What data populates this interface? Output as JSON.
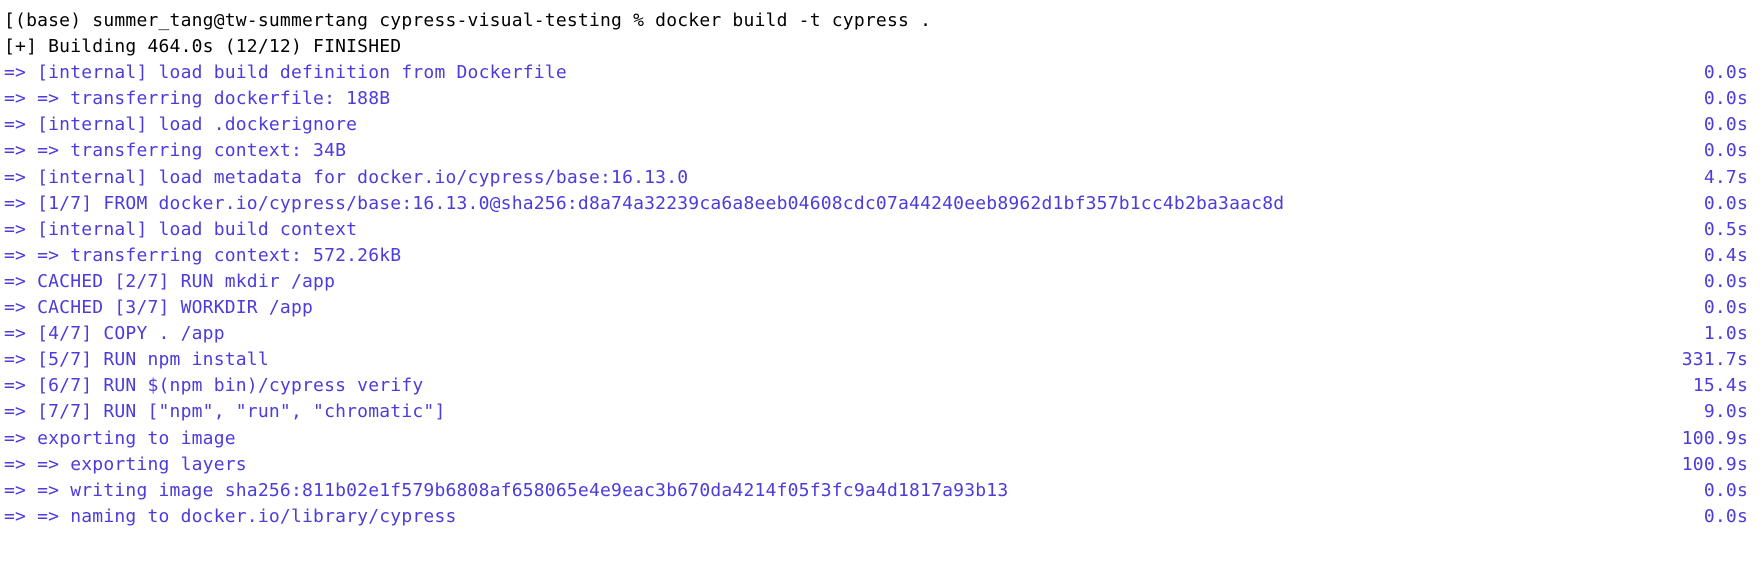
{
  "prompt": {
    "text": "[(base) summer_tang@tw-summertang cypress-visual-testing % docker build -t cypress ."
  },
  "status": {
    "text": "[+] Building 464.0s (12/12) FINISHED"
  },
  "lines": [
    {
      "left": " => [internal] load build definition from Dockerfile",
      "right": "0.0s"
    },
    {
      "left": " => => transferring dockerfile: 188B",
      "right": "0.0s"
    },
    {
      "left": " => [internal] load .dockerignore",
      "right": "0.0s"
    },
    {
      "left": " => => transferring context: 34B",
      "right": "0.0s"
    },
    {
      "left": " => [internal] load metadata for docker.io/cypress/base:16.13.0",
      "right": "4.7s"
    },
    {
      "left": " => [1/7] FROM docker.io/cypress/base:16.13.0@sha256:d8a74a32239ca6a8eeb04608cdc07a44240eeb8962d1bf357b1cc4b2ba3aac8d",
      "right": "0.0s"
    },
    {
      "left": " => [internal] load build context",
      "right": "0.5s"
    },
    {
      "left": " => => transferring context: 572.26kB",
      "right": "0.4s"
    },
    {
      "left": " => CACHED [2/7] RUN mkdir /app",
      "right": "0.0s"
    },
    {
      "left": " => CACHED [3/7] WORKDIR /app",
      "right": "0.0s"
    },
    {
      "left": " => [4/7] COPY . /app",
      "right": "1.0s"
    },
    {
      "left": " => [5/7] RUN npm install",
      "right": "331.7s"
    },
    {
      "left": " => [6/7] RUN $(npm bin)/cypress verify",
      "right": "15.4s"
    },
    {
      "left": " => [7/7] RUN [\"npm\", \"run\", \"chromatic\"]",
      "right": "9.0s"
    },
    {
      "left": " => exporting to image",
      "right": "100.9s"
    },
    {
      "left": " => => exporting layers",
      "right": "100.9s"
    },
    {
      "left": " => => writing image sha256:811b02e1f579b6808af658065e4e9eac3b670da4214f05f3fc9a4d1817a93b13",
      "right": "0.0s"
    },
    {
      "left": " => => naming to docker.io/library/cypress",
      "right": "0.0s"
    }
  ]
}
